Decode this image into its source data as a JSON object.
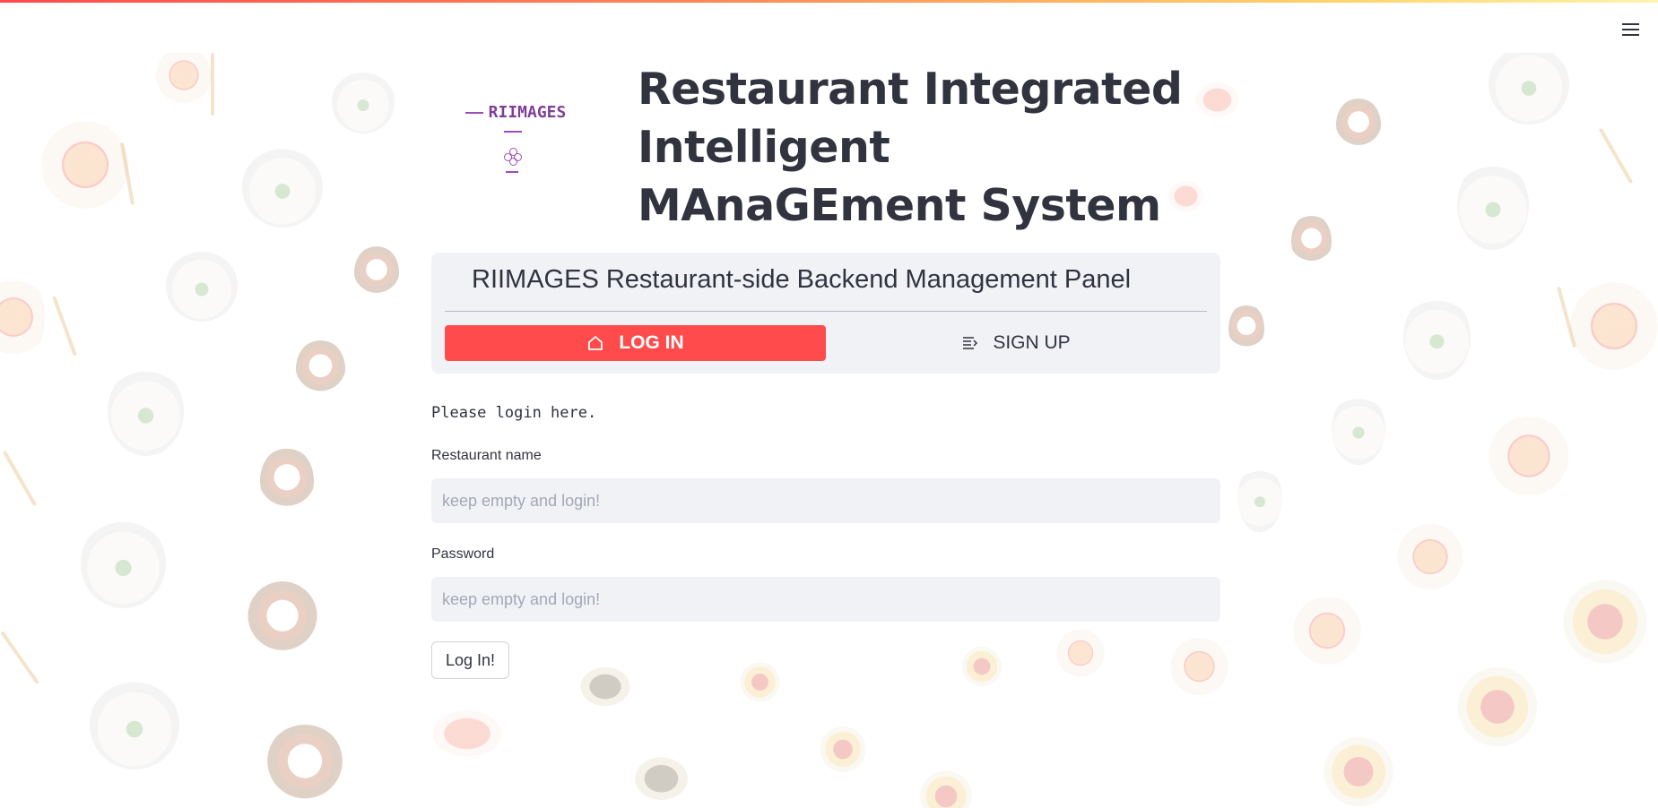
{
  "header": {
    "logo_text": "RIIMAGES",
    "title": "Restaurant Integrated Intelligent MAnaGEment System"
  },
  "panel": {
    "title": "RIIMAGES Restaurant-side Backend Management Panel",
    "tabs": [
      {
        "label": "LOG IN",
        "icon": "home-icon",
        "active": true
      },
      {
        "label": "SIGN UP",
        "icon": "list-icon",
        "active": false
      }
    ]
  },
  "form": {
    "intro": "Please login here.",
    "restaurant_name_label": "Restaurant name",
    "restaurant_name_placeholder": "keep empty and login!",
    "restaurant_name_value": "",
    "password_label": "Password",
    "password_placeholder": "keep empty and login!",
    "password_value": "",
    "submit_label": "Log In!"
  },
  "colors": {
    "accent": "#ff4b4b",
    "logo": "#7f3f98",
    "panel_bg": "#f0f2f6",
    "text": "#31333f"
  },
  "icons": {
    "menu": "hamburger-menu-icon"
  }
}
